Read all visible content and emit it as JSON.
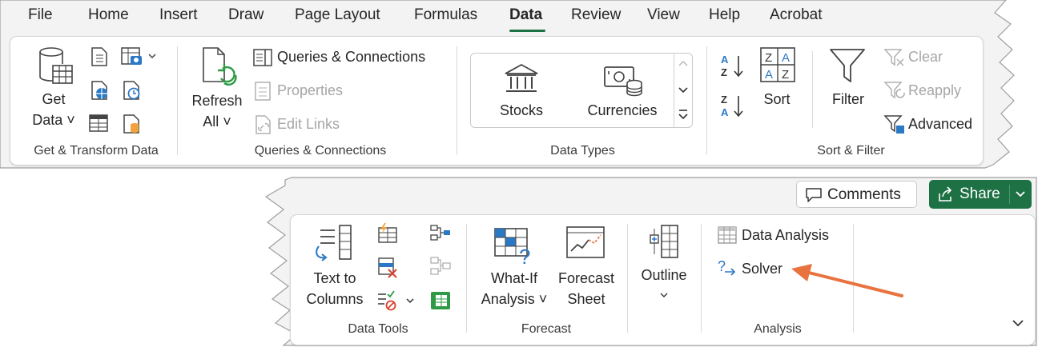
{
  "tabs": [
    {
      "label": "File"
    },
    {
      "label": "Home"
    },
    {
      "label": "Insert"
    },
    {
      "label": "Draw"
    },
    {
      "label": "Page Layout"
    },
    {
      "label": "Formulas"
    },
    {
      "label": "Data"
    },
    {
      "label": "Review"
    },
    {
      "label": "View"
    },
    {
      "label": "Help"
    },
    {
      "label": "Acrobat"
    }
  ],
  "active_tab": "Data",
  "groups": {
    "get_transform": {
      "label": "Get & Transform Data",
      "get_data": {
        "line1": "Get",
        "line2": "Data ˅"
      }
    },
    "queries": {
      "label": "Queries & Connections",
      "refresh": {
        "line1": "Refresh",
        "line2": "All ˅"
      },
      "queries_connections": "Queries & Connections",
      "properties": "Properties",
      "edit_links": "Edit Links"
    },
    "data_types": {
      "label": "Data Types",
      "stocks": "Stocks",
      "currencies": "Currencies"
    },
    "sort_filter": {
      "label": "Sort & Filter",
      "sort": "Sort",
      "filter": "Filter",
      "clear": "Clear",
      "reapply": "Reapply",
      "advanced": "Advanced"
    },
    "data_tools": {
      "label": "Data Tools",
      "text_to_columns": {
        "line1": "Text to",
        "line2": "Columns"
      }
    },
    "forecast": {
      "label": "Forecast",
      "what_if": {
        "line1": "What-If",
        "line2": "Analysis ˅"
      },
      "forecast_sheet": {
        "line1": "Forecast",
        "line2": "Sheet"
      }
    },
    "outline": {
      "label": "Outline"
    },
    "analysis": {
      "label": "Analysis",
      "data_analysis": "Data Analysis",
      "solver": "Solver"
    }
  },
  "header_buttons": {
    "comments": "Comments",
    "share": "Share"
  },
  "colors": {
    "accent_green": "#1e7145",
    "annotation_arrow": "#e9733f",
    "icon_blue": "#2b78c5",
    "disabled_gray": "#a6a6a6"
  },
  "icons": [
    "database-grid-icon",
    "refresh-icon",
    "bank-icon",
    "currency-icon",
    "sort-az-icon",
    "funnel-icon",
    "text-columns-icon",
    "what-if-grid-icon",
    "forecast-chart-icon",
    "outline-icon",
    "solver-icon",
    "comment-icon",
    "share-icon"
  ]
}
